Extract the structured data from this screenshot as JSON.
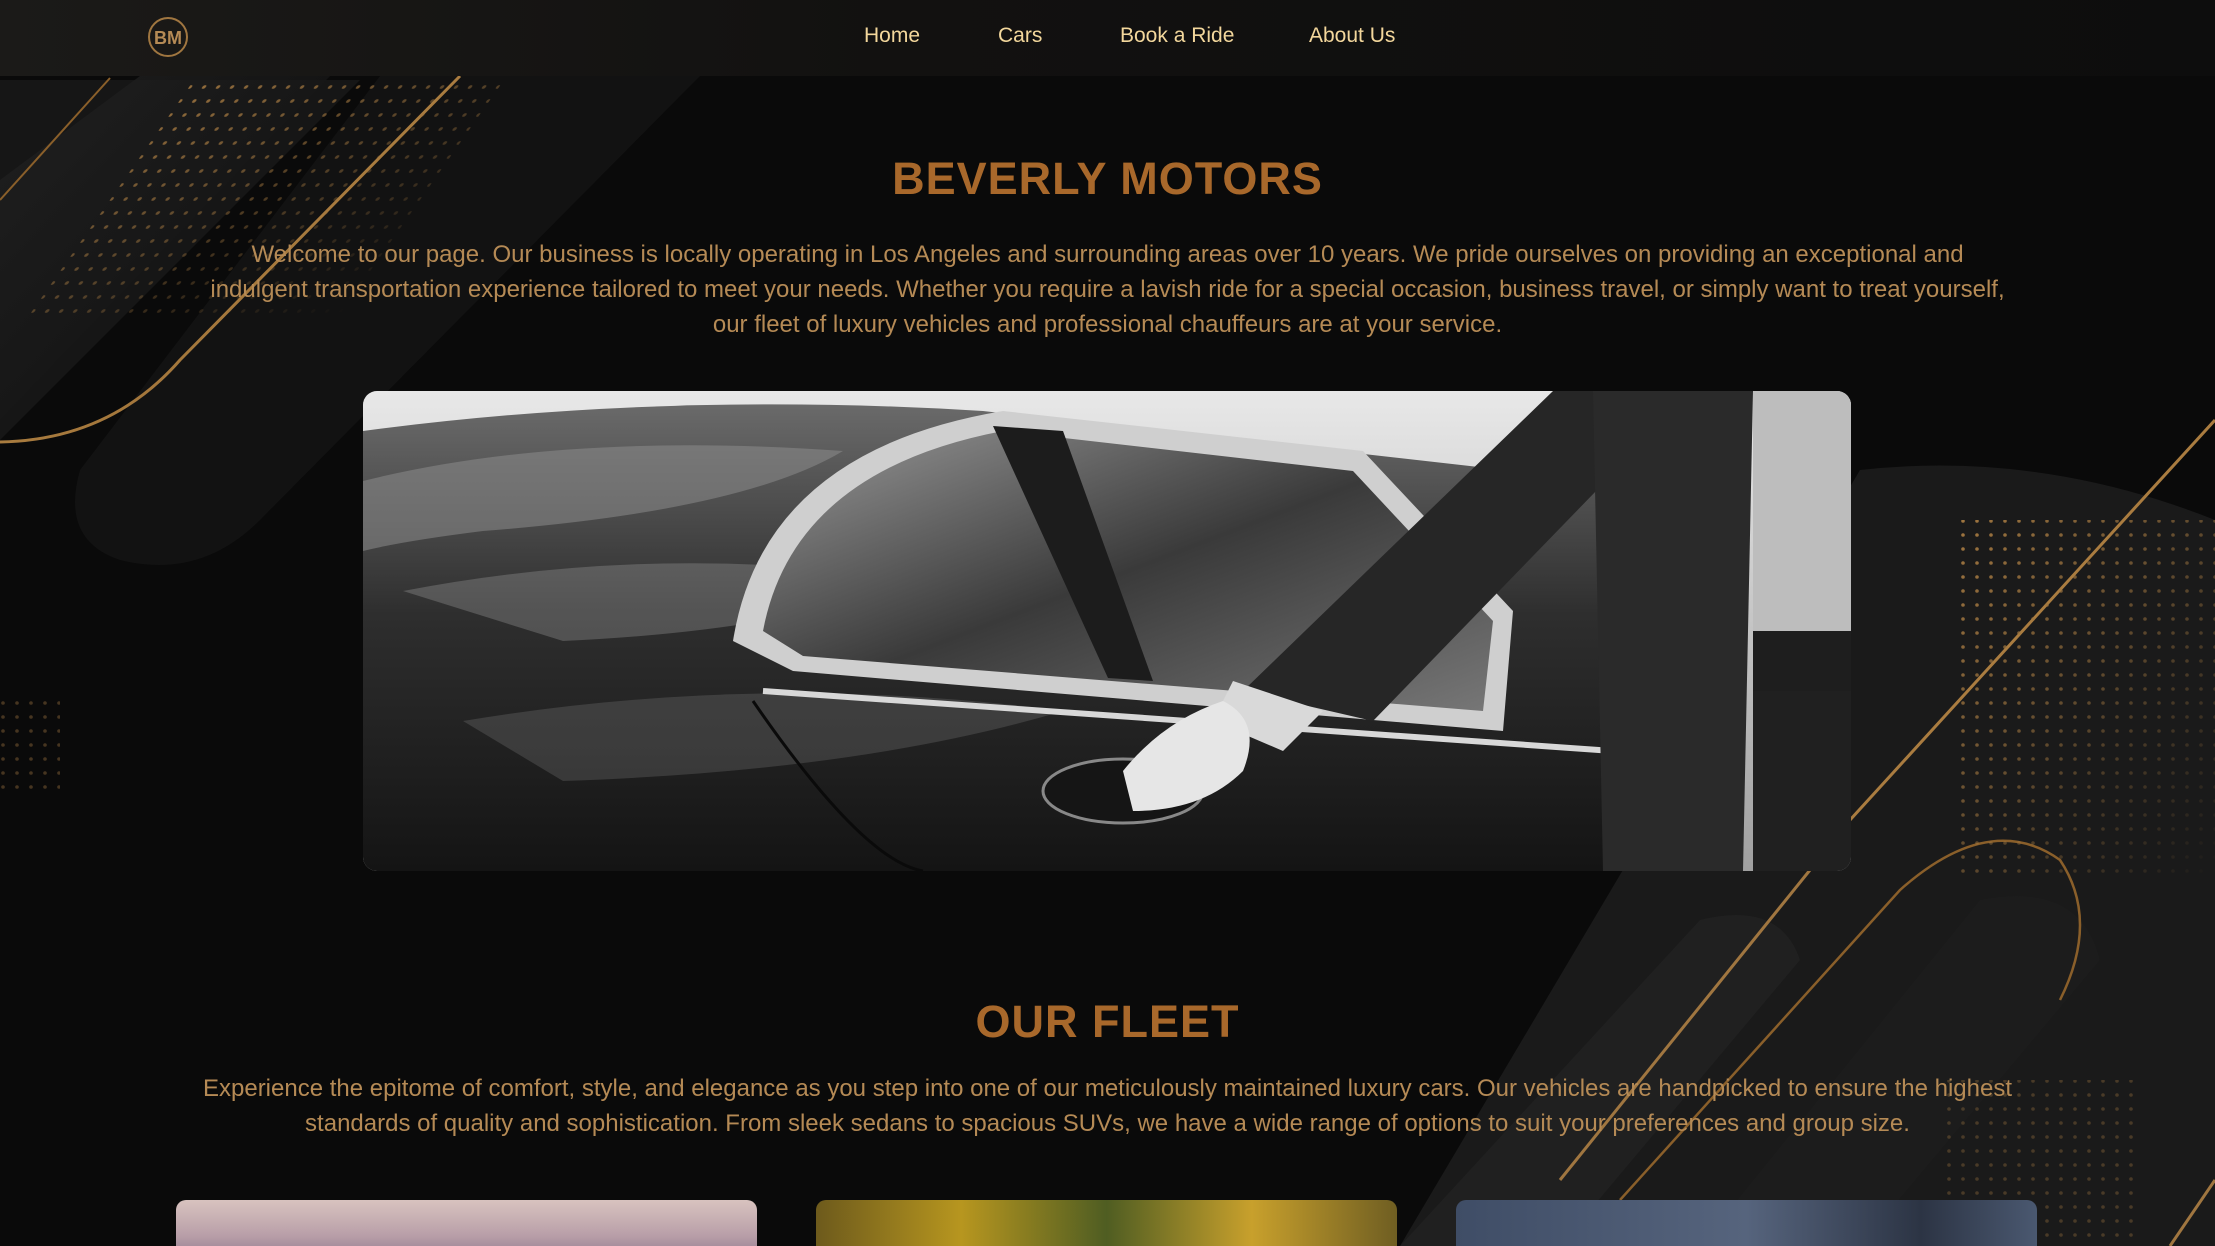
{
  "nav": {
    "logo_text": "BM",
    "links": [
      "Home",
      "Cars",
      "Book a Ride",
      "About Us"
    ]
  },
  "hero": {
    "title": "BEVERLY MOTORS",
    "description": "Welcome to our page. Our business is locally operating in Los Angeles and surrounding areas over 10 years. We pride ourselves on providing an exceptional and indulgent transportation experience tailored to meet your needs. Whether you require a lavish ride for a special occasion, business travel, or simply want to treat yourself, our fleet of luxury vehicles and professional chauffeurs are at your service."
  },
  "fleet": {
    "title": "OUR FLEET",
    "description": "Experience the epitome of comfort, style, and elegance as you step into one of our meticulously maintained luxury cars. Our vehicles are handpicked to ensure the highest standards of quality and sophistication. From sleek sedans to spacious SUVs, we have a wide range of options to suit your preferences and group size."
  },
  "colors": {
    "accent_gold": "#a8682b",
    "text_gold": "#b58a55",
    "nav_text": "#f3d79c",
    "background": "#0b0b0b"
  }
}
